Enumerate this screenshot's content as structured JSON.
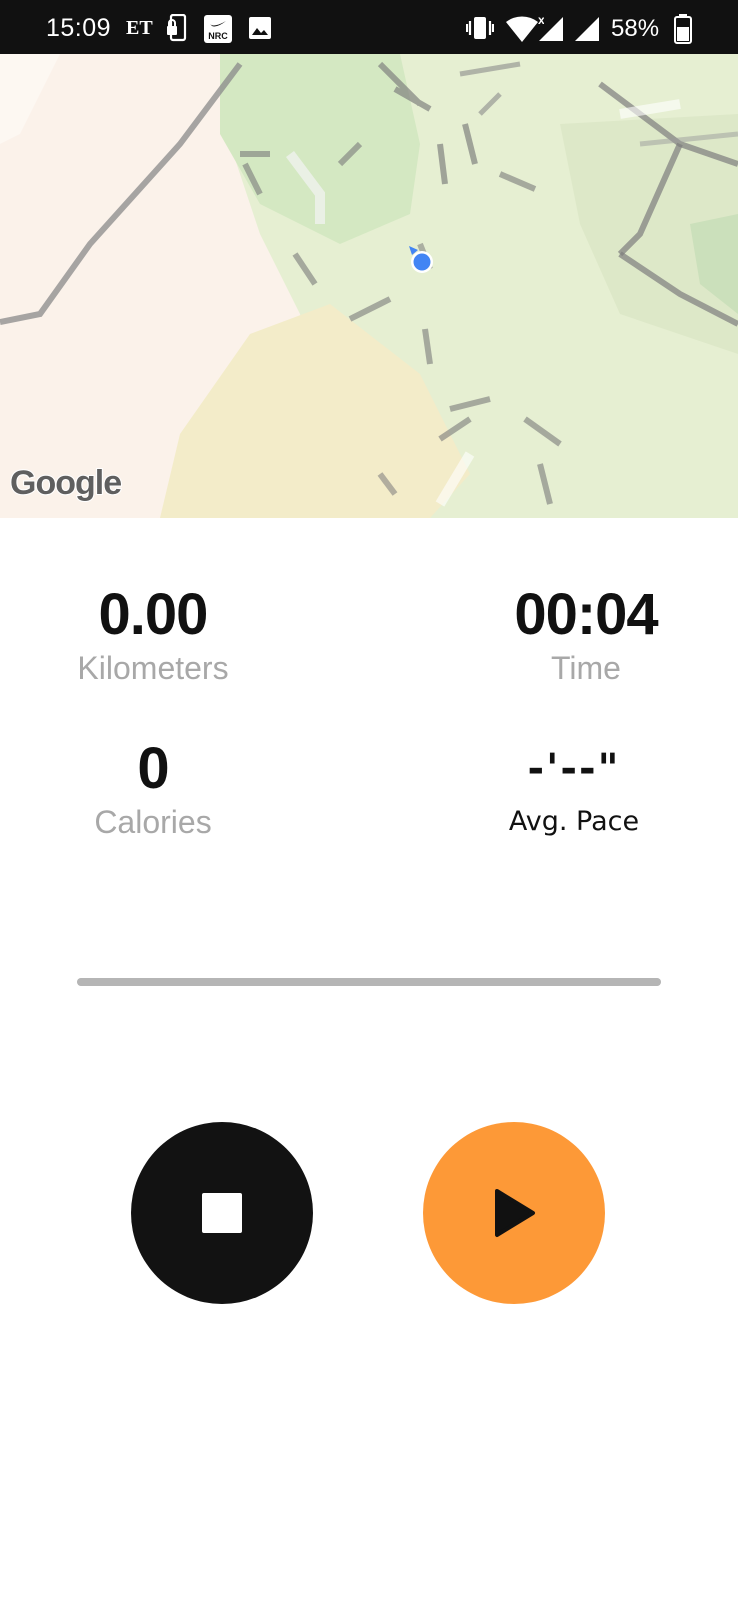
{
  "status_bar": {
    "time": "15:09",
    "carrier": "ET",
    "battery_percent": "58%",
    "icons": [
      "phone-lock-icon",
      "nrc-app-icon",
      "image-icon",
      "vibrate-icon",
      "wifi-icon",
      "signal-icon",
      "signal-icon",
      "battery-icon"
    ],
    "nrc_badge": "NRC"
  },
  "map": {
    "provider": "Google",
    "icons": [
      "location-dot-icon"
    ]
  },
  "stats": {
    "distance": {
      "value": "0.00",
      "label": "Kilometers"
    },
    "time": {
      "value": "00:04",
      "label": "Time"
    },
    "calories": {
      "value": "0",
      "label": "Calories"
    },
    "pace": {
      "value": "-'--\"",
      "label": "Avg. Pace"
    }
  },
  "progress": {
    "fraction": 1.0
  },
  "controls": {
    "stop": {
      "icon": "stop-icon",
      "color": "#121212"
    },
    "resume": {
      "icon": "play-icon",
      "color": "#fd9937"
    }
  },
  "colors": {
    "status_bar_bg": "#111111",
    "label_gray": "#a8a8a8",
    "value_dark": "#111111",
    "accent_orange": "#fd9937",
    "location_blue": "#4285f4"
  }
}
